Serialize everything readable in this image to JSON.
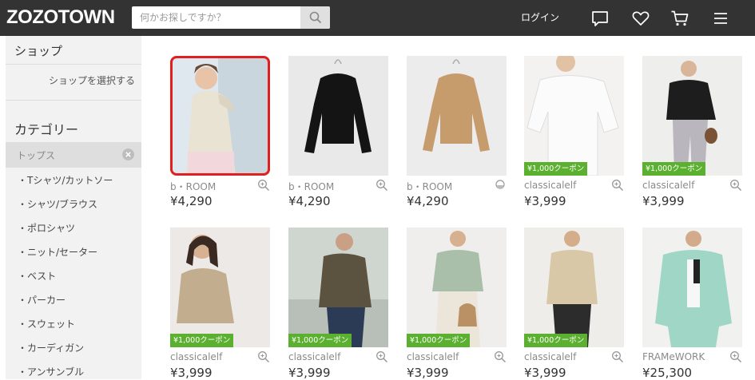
{
  "header": {
    "logo": "ZOZOTOWN",
    "search_placeholder": "何かお探しですか？",
    "login_label": "ログイン",
    "icons": [
      "search-icon",
      "chat-icon",
      "heart-icon",
      "cart-icon",
      "menu-icon"
    ]
  },
  "sidebar": {
    "shop_heading": "ショップ",
    "shop_select": "ショップを選択する",
    "category_heading": "カテゴリー",
    "selected_category": "トップス",
    "items": [
      "・Tシャツ/カットソー",
      "・シャツ/ブラウス",
      "・ポロシャツ",
      "・ニット/セーター",
      "・ベスト",
      "・パーカー",
      "・スウェット",
      "・カーディガン",
      "・アンサンブル"
    ]
  },
  "products": [
    {
      "brand": "b・ROOM",
      "price": "¥4,290",
      "coupon": "",
      "selected": true
    },
    {
      "brand": "b・ROOM",
      "price": "¥4,290",
      "coupon": ""
    },
    {
      "brand": "b・ROOM",
      "price": "¥4,290",
      "coupon": ""
    },
    {
      "brand": "classicalelf",
      "price": "¥3,999",
      "coupon": "¥1,000クーポン"
    },
    {
      "brand": "classicalelf",
      "price": "¥3,999",
      "coupon": "¥1,000クーポン"
    },
    {
      "brand": "classicalelf",
      "price": "¥3,999",
      "coupon": "¥1,000クーポン"
    },
    {
      "brand": "classicalelf",
      "price": "¥3,999",
      "coupon": "¥1,000クーポン"
    },
    {
      "brand": "classicalelf",
      "price": "¥3,999",
      "coupon": "¥1,000クーポン"
    },
    {
      "brand": "classicalelf",
      "price": "¥3,999",
      "coupon": "¥1,000クーポン"
    },
    {
      "brand": "FRAMeWORK",
      "price": "¥25,300",
      "coupon": ""
    }
  ],
  "colors": {
    "header": "#333333",
    "coupon": "#5bb030",
    "selection": "#e02020",
    "sidebar": "#f2f2f2"
  }
}
